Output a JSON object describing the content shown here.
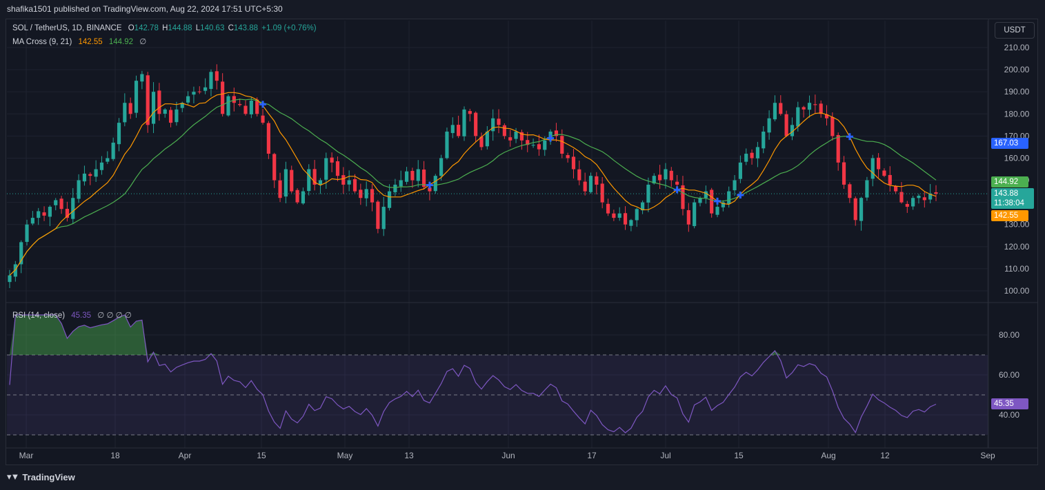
{
  "header": {
    "published": "shafika1501 published on TradingView.com, Aug 22, 2024 17:51 UTC+5:30"
  },
  "legend": {
    "symbol": "SOL / TetherUS, 1D, BINANCE",
    "o_label": "O",
    "o": "142.78",
    "h_label": "H",
    "h": "144.88",
    "l_label": "L",
    "l": "140.63",
    "c_label": "C",
    "c": "143.88",
    "change": "+1.09 (+0.76%)",
    "ma_label": "MA Cross (9, 21)",
    "ma_fast": "142.55",
    "ma_slow": "144.92",
    "ma_null": "∅",
    "rsi_label": "RSI (14, close)",
    "rsi_value": "45.35",
    "rsi_nulls": "∅ ∅ ∅ ∅"
  },
  "currency": "USDT",
  "badges": {
    "level": "167.03",
    "ma_slow": "144.92",
    "last_price": "143.88",
    "countdown": "11:38:04",
    "ma_fast": "142.55",
    "rsi": "45.35"
  },
  "colors": {
    "up": "#26a69a",
    "down": "#f23645",
    "ma_fast": "#ff9800",
    "ma_slow": "#4caf50",
    "rsi": "#7e57c2",
    "cross": "#2962ff",
    "background": "#131722",
    "grid": "#1f2330"
  },
  "brand": {
    "name": "TradingView",
    "icon": "tradingview-logo-icon"
  },
  "chart_data": [
    {
      "type": "candlestick",
      "title": "SOL / TetherUS, 1D, BINANCE",
      "y_ticks": [
        "210.00",
        "200.00",
        "190.00",
        "180.00",
        "170.00",
        "160.00",
        "150.00",
        "140.00",
        "130.00",
        "120.00",
        "110.00",
        "100.00"
      ],
      "ylim": [
        97,
        214
      ],
      "x_ticks": [
        "Mar",
        "18",
        "Apr",
        "15",
        "May",
        "13",
        "Jun",
        "17",
        "Jul",
        "15",
        "Aug",
        "12",
        "Sep"
      ],
      "grid": true,
      "closes": [
        107,
        112,
        122,
        130,
        133,
        136,
        134,
        138,
        141,
        137,
        133,
        142,
        150,
        153,
        152,
        155,
        158,
        160,
        167,
        176,
        185,
        180,
        195,
        198,
        175,
        190,
        180,
        182,
        176,
        182,
        185,
        188,
        190,
        190,
        192,
        199,
        195,
        180,
        188,
        185,
        184,
        180,
        186,
        180,
        176,
        162,
        150,
        142,
        155,
        145,
        140,
        145,
        155,
        148,
        150,
        160,
        158,
        152,
        148,
        150,
        145,
        142,
        146,
        140,
        128,
        138,
        145,
        148,
        150,
        154,
        150,
        155,
        147,
        145,
        152,
        160,
        172,
        175,
        170,
        182,
        180,
        170,
        165,
        172,
        178,
        175,
        170,
        168,
        172,
        168,
        166,
        166,
        164,
        168,
        172,
        170,
        162,
        160,
        155,
        150,
        145,
        152,
        148,
        140,
        135,
        133,
        135,
        130,
        132,
        137,
        140,
        148,
        152,
        150,
        155,
        150,
        148,
        137,
        130,
        140,
        142,
        145,
        135,
        138,
        140,
        145,
        150,
        158,
        162,
        160,
        165,
        172,
        178,
        185,
        180,
        170,
        175,
        183,
        182,
        185,
        184,
        180,
        178,
        170,
        158,
        148,
        142,
        132,
        142,
        150,
        160,
        155,
        152,
        148,
        145,
        140,
        138,
        142,
        143,
        141,
        144,
        143.88
      ],
      "ma_fast_last": 142.55,
      "ma_slow_last": 144.92,
      "last_price": 143.88,
      "level": 167.03,
      "ma_cross_markers": 9
    },
    {
      "type": "line",
      "title": "RSI (14, close)",
      "y_ticks": [
        "80.00",
        "60.00",
        "40.00"
      ],
      "ylim": [
        25,
        92
      ],
      "bands": [
        30,
        50,
        70
      ],
      "last_value": 45.35
    }
  ]
}
